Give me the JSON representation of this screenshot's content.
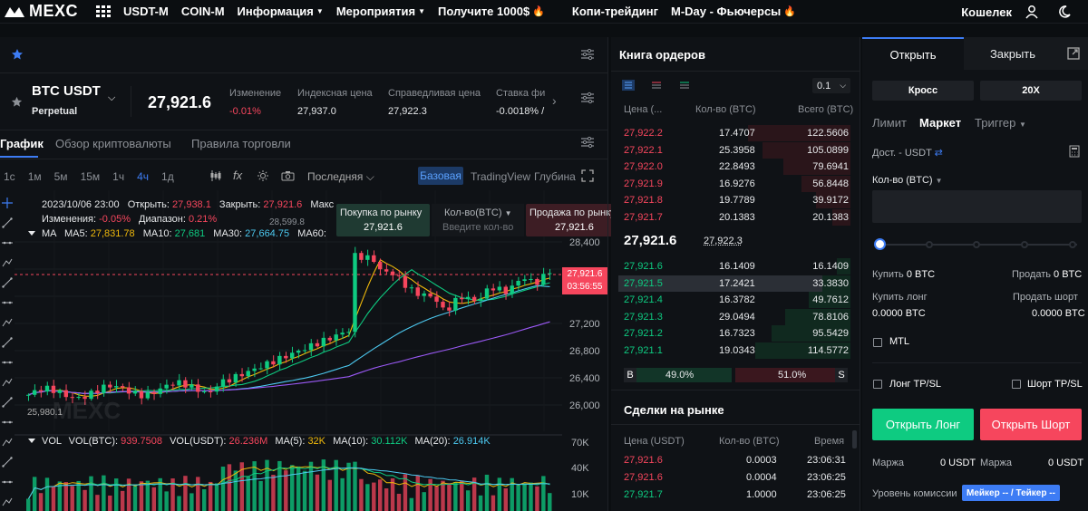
{
  "nav": {
    "logo_text": "MEXC",
    "items": [
      {
        "label": "USDT-M"
      },
      {
        "label": "COIN-M"
      },
      {
        "label": "Информация"
      },
      {
        "label": "Мероприятия"
      },
      {
        "label": "Получите 1000$"
      },
      {
        "label": "Копи-трейдинг"
      },
      {
        "label": "M-Day - Фьючерсы"
      }
    ],
    "wallet": "Кошелек"
  },
  "instrument": {
    "symbol": "BTC USDT",
    "type": "Perpetual",
    "last_price": "27,921.6",
    "change_label": "Изменение",
    "change_value": "-0.01%",
    "index_label": "Индексная цена",
    "index_value": "27,937.0",
    "fair_label": "Справедливая цена",
    "fair_value": "27,922.3",
    "funding_label": "Ставка фи",
    "funding_value": "-0.0018% /"
  },
  "tabs": {
    "chart": "График",
    "overview": "Обзор криптовалюты",
    "rules": "Правила торговли"
  },
  "toolbar": {
    "intervals": [
      "1с",
      "1м",
      "5м",
      "15м",
      "1ч",
      "4ч",
      "1д"
    ],
    "active_interval": "4ч",
    "price_type": "Последняя",
    "view_basic": "Базовая",
    "view_tv": "TradingView",
    "view_depth": "Глубина"
  },
  "legend": {
    "date": "2023/10/06 23:00",
    "open_label": "Открыть:",
    "open": "27,938.1",
    "close_label": "Закрыть:",
    "close": "27,921.6",
    "max_label": "Макс",
    "changes_label": "Изменения:",
    "changes": "-0.05%",
    "range_label": "Диапазон:",
    "range": "0.21%",
    "ma_label": "MA",
    "ma5_label": "MA5:",
    "ma5": "27,831.78",
    "ma10_label": "MA10:",
    "ma10": "27,681",
    "ma30_label": "MA30:",
    "ma30": "27,664.75",
    "ma60_label": "MA60:",
    "vol_label": "VOL",
    "volbtc_label": "VOL(BTC):",
    "volbtc": "939.7508",
    "volusdt_label": "VOL(USDT):",
    "volusdt": "26.236M",
    "vma5_label": "MA(5):",
    "vma5": "32K",
    "vma10_label": "MA(10):",
    "vma10": "30.112K",
    "vma20_label": "MA(20):",
    "vma20": "26.914K"
  },
  "quick_trade": {
    "buy_label": "Покупка по рынку",
    "buy_price": "27,921.6",
    "qty_label": "Кол-во(BTC)",
    "qty_placeholder": "Введите кол-во",
    "sell_label": "Продажа по рынку",
    "sell_price": "27,921.6",
    "high_marker": "28,599.8"
  },
  "chart_data": {
    "type": "candlestick",
    "y_ticks": [
      "28,400",
      "27,600",
      "27,200",
      "26,800",
      "26,400",
      "26,000"
    ],
    "vol_ticks": [
      "70K",
      "40K",
      "10K"
    ],
    "current_price_label": "27,921.6",
    "countdown": "03:56:55",
    "low_marker": "25,980.1",
    "watermark": "MEXC"
  },
  "orderbook": {
    "title": "Книга ордеров",
    "step": "0.1",
    "col_price": "Цена (...",
    "col_qty": "Кол-во (BTC)",
    "col_total": "Всего (BTC)",
    "asks": [
      {
        "price": "27,922.2",
        "qty": "17.4707",
        "total": "122.5606",
        "depth": 0.44
      },
      {
        "price": "27,922.1",
        "qty": "25.3958",
        "total": "105.0899",
        "depth": 0.38
      },
      {
        "price": "27,922.0",
        "qty": "22.8493",
        "total": "79.6941",
        "depth": 0.29
      },
      {
        "price": "27,921.9",
        "qty": "16.9276",
        "total": "56.8448",
        "depth": 0.21
      },
      {
        "price": "27,921.8",
        "qty": "19.7789",
        "total": "39.9172",
        "depth": 0.15
      },
      {
        "price": "27,921.7",
        "qty": "20.1383",
        "total": "20.1383",
        "depth": 0.08
      }
    ],
    "mid_price": "27,921.6",
    "mid_mark": "27,922.3",
    "bids": [
      {
        "price": "27,921.6",
        "qty": "16.1409",
        "total": "16.1409",
        "depth": 0.06
      },
      {
        "price": "27,921.5",
        "qty": "17.2421",
        "total": "33.3830",
        "depth": 0.12
      },
      {
        "price": "27,921.4",
        "qty": "16.3782",
        "total": "49.7612",
        "depth": 0.18
      },
      {
        "price": "27,921.3",
        "qty": "29.0494",
        "total": "78.8106",
        "depth": 0.28
      },
      {
        "price": "27,921.2",
        "qty": "16.7323",
        "total": "95.5429",
        "depth": 0.34
      },
      {
        "price": "27,921.1",
        "qty": "19.0343",
        "total": "114.5772",
        "depth": 0.41
      }
    ],
    "buy_letter": "B",
    "buy_pct": "49.0%",
    "sell_pct": "51.0%",
    "sell_letter": "S"
  },
  "trades": {
    "title": "Сделки на рынке",
    "col_price": "Цена (USDT)",
    "col_qty": "Кол-во (BTC)",
    "col_time": "Время",
    "rows": [
      {
        "price": "27,921.6",
        "qty": "0.0003",
        "time": "23:06:31",
        "side": "sell"
      },
      {
        "price": "27,921.6",
        "qty": "0.0004",
        "time": "23:06:25",
        "side": "sell"
      },
      {
        "price": "27,921.7",
        "qty": "1.0000",
        "time": "23:06:25",
        "side": "buy"
      }
    ]
  },
  "trade_panel": {
    "tab_open": "Открыть",
    "tab_close": "Закрыть",
    "margin_mode": "Кросс",
    "leverage": "20X",
    "order_limit": "Лимит",
    "order_market": "Маркет",
    "order_trigger": "Триггер",
    "available_label": "Дост. - USDT",
    "qty_label": "Кол-во (BTC)",
    "buy_label": "Купить",
    "buy_value": "0 BTC",
    "sell_label": "Продать",
    "sell_value": "0 BTC",
    "buy_long_label": "Купить лонг",
    "buy_long_value": "0.0000 BTC",
    "sell_short_label": "Продать шорт",
    "sell_short_value": "0.0000 BTC",
    "mtl": "MTL",
    "long_tpsl": "Лонг TP/SL",
    "short_tpsl": "Шорт TP/SL",
    "open_long": "Открыть Лонг",
    "open_short": "Открыть Шорт",
    "margin_label": "Маржа",
    "margin_long": "0 USDT",
    "margin_short": "0 USDT",
    "fee_label": "Уровень комиссии",
    "fee_badge": "Мейкер -- / Тейкер --"
  },
  "colors": {
    "green": "#0ecb81",
    "red": "#f6465d",
    "accent": "#3d7cf4"
  }
}
